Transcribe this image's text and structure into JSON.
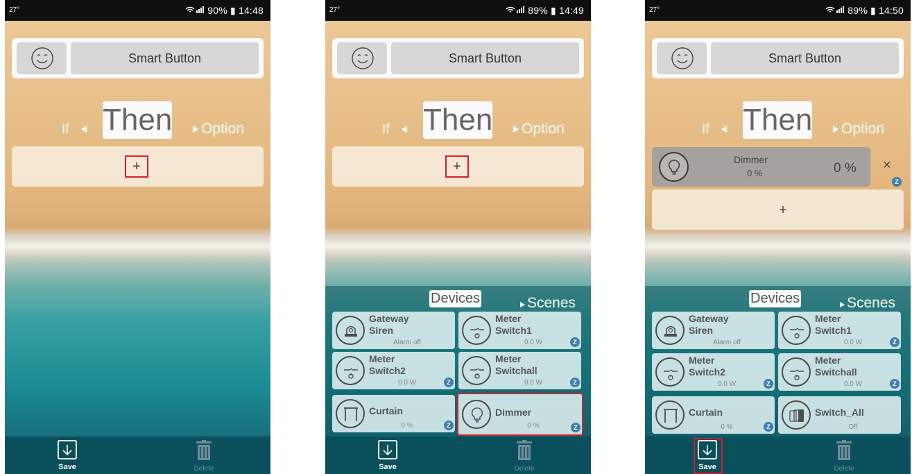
{
  "screens": [
    {
      "status": {
        "left": "27°",
        "right": "90% ▮ 14:48"
      },
      "header": {
        "name": "Smart Button"
      },
      "tabs": {
        "if": "If",
        "then": "Then",
        "option": "Option"
      },
      "add_label": "+",
      "footer": {
        "save": "Save",
        "delete": "Delete"
      }
    },
    {
      "status": {
        "left": "27°",
        "right": "89% ▮ 14:49"
      },
      "header": {
        "name": "Smart Button"
      },
      "tabs": {
        "if": "If",
        "then": "Then",
        "option": "Option"
      },
      "add_label": "+",
      "panel": {
        "devices": "Devices",
        "scenes": "Scenes"
      },
      "devices": [
        {
          "name": "Gateway\nSiren",
          "status": "Alarm off",
          "icon": "siren-icon"
        },
        {
          "name": "Meter\nSwitch1",
          "status": "0.0 W",
          "icon": "meter-switch-icon"
        },
        {
          "name": "Meter\nSwitch2",
          "status": "0.0 W",
          "icon": "meter-switch-icon"
        },
        {
          "name": "Meter\nSwitchall",
          "status": "0.0 W",
          "icon": "meter-switch-icon"
        },
        {
          "name": "Curtain",
          "status": "0 %",
          "icon": "curtain-icon"
        },
        {
          "name": "Dimmer",
          "status": "0 %",
          "icon": "bulb-icon"
        }
      ],
      "footer": {
        "save": "Save",
        "delete": "Delete"
      }
    },
    {
      "status": {
        "left": "27°",
        "right": "89% ▮ 14:50"
      },
      "header": {
        "name": "Smart Button"
      },
      "tabs": {
        "if": "If",
        "then": "Then",
        "option": "Option"
      },
      "action": {
        "name": "Dimmer",
        "sub": "0 %",
        "value": "0 %",
        "close": "×"
      },
      "add_label": "+",
      "panel": {
        "devices": "Devices",
        "scenes": "Scenes"
      },
      "devices": [
        {
          "name": "Gateway\nSiren",
          "status": "Alarm off",
          "icon": "siren-icon"
        },
        {
          "name": "Meter\nSwitch1",
          "status": "0.0 W",
          "icon": "meter-switch-icon"
        },
        {
          "name": "Meter\nSwitch2",
          "status": "0.0 W",
          "icon": "meter-switch-icon"
        },
        {
          "name": "Meter\nSwitchall",
          "status": "0.0 W",
          "icon": "meter-switch-icon"
        },
        {
          "name": "Curtain",
          "status": "0 %",
          "icon": "curtain-icon"
        },
        {
          "name": "Switch_All",
          "status": "Off",
          "icon": "switch-all-icon"
        }
      ],
      "footer": {
        "save": "Save",
        "delete": "Delete"
      }
    }
  ],
  "z_badge": "Z",
  "colors": {
    "highlight": "#d21f2f",
    "z_badge": "#3f7fb0"
  }
}
